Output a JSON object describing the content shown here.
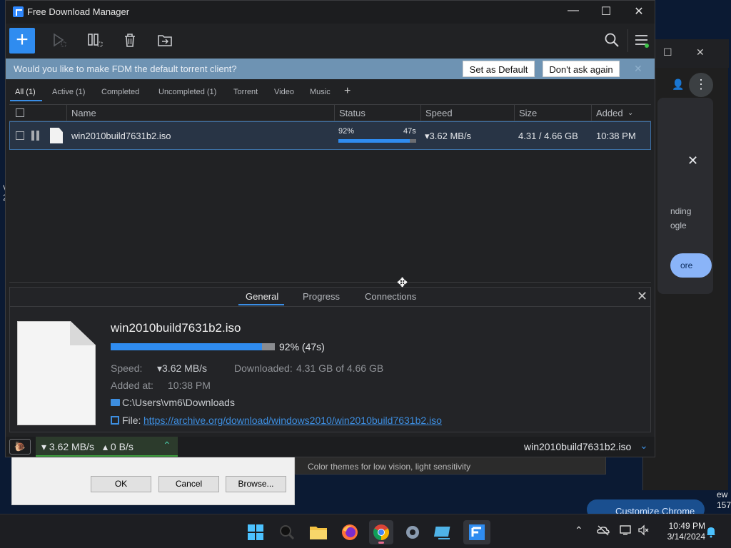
{
  "window": {
    "title": "Free Download Manager",
    "minimize": "—",
    "maximize": "☐",
    "close": "✕"
  },
  "toolbar": {
    "add": "+"
  },
  "banner": {
    "text": "Would you like to make FDM the default torrent client?",
    "set_default": "Set as Default",
    "dont_ask": "Don't ask again",
    "close": "✕"
  },
  "filters": [
    "All (1)",
    "Active (1)",
    "Completed",
    "Uncompleted (1)",
    "Torrent",
    "Video",
    "Music"
  ],
  "filter_add": "+",
  "columns": {
    "name": "Name",
    "status": "Status",
    "speed": "Speed",
    "size": "Size",
    "added": "Added"
  },
  "download": {
    "filename": "win2010build7631b2.iso",
    "percent": "92%",
    "progress": 0.92,
    "eta": "47s",
    "speed": "▾3.62 MB/s",
    "size": "4.31 / 4.66 GB",
    "added": "10:38 PM"
  },
  "details": {
    "tabs": [
      "General",
      "Progress",
      "Connections"
    ],
    "close": "✕",
    "filename": "win2010build7631b2.iso",
    "percent_text": "92% (47s)",
    "speed_label": "Speed:",
    "speed_value": "▾3.62 MB/s",
    "downloaded_label": "Downloaded:",
    "downloaded_value": "4.31 GB of 4.66 GB",
    "added_label": "Added at:",
    "added_value": "10:38 PM",
    "folder": "C:\\Users\\vm6\\Downloads",
    "file_label": "File:",
    "file_url": "https://archive.org/download/windows2010/win2010build7631b2.iso"
  },
  "statusbar": {
    "down_speed": "▾ 3.62 MB/s",
    "up_speed": "▴ 0 B/s",
    "current_file": "win2010build7631b2.iso"
  },
  "background": {
    "chrome_texts": [
      "nding",
      "ogle"
    ],
    "chrome_button": "ore",
    "customize_chrome": "Customize Chrome",
    "settings_text": "Color themes for low vision, light sensitivity",
    "side_texts": [
      "ew",
      "157"
    ],
    "left_texts": [
      "V",
      "2"
    ],
    "dialog_ok": "OK",
    "dialog_cancel": "Cancel",
    "dialog_browse": "Browse..."
  },
  "taskbar": {
    "time": "10:49 PM",
    "date": "3/14/2024"
  },
  "colors": {
    "accent": "#2f8cf0",
    "banner": "#6e93b3",
    "row_selected": "#283445",
    "speed_ok": "#3fa33f"
  }
}
